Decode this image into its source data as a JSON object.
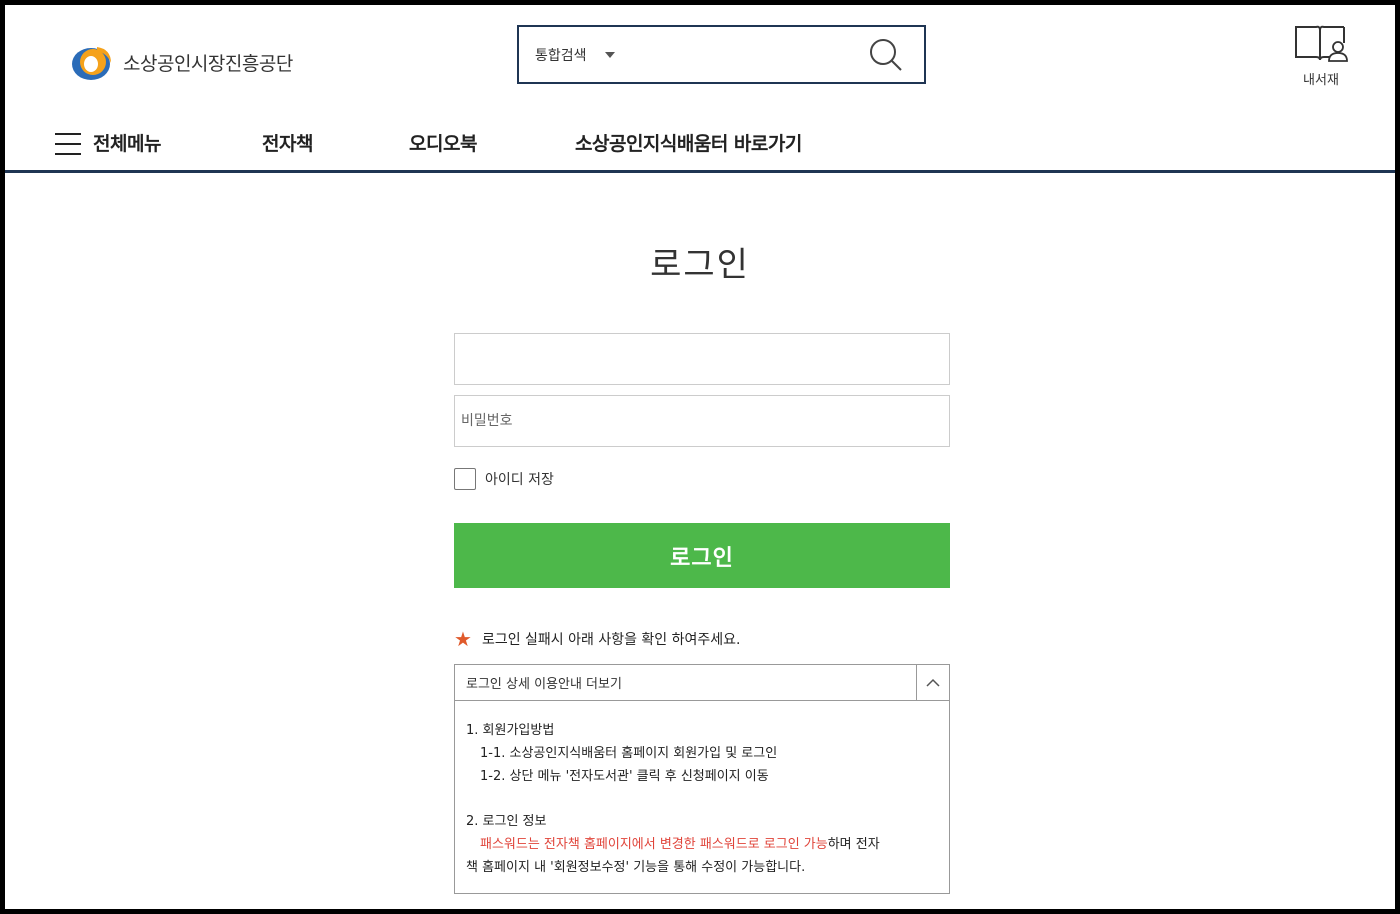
{
  "header": {
    "logo_text": "소상공인시장진흥공단",
    "search": {
      "scope": "통합검색",
      "placeholder": ""
    },
    "mylib_label": "내서재"
  },
  "nav": {
    "all_menu": "전체메뉴",
    "items": [
      "전자책",
      "오디오북",
      "소상공인지식배움터 바로가기"
    ]
  },
  "login": {
    "title": "로그인",
    "id_placeholder": "",
    "password_placeholder": "비밀번호",
    "remember_label": "아이디 저장",
    "submit_label": "로그인"
  },
  "notice": {
    "text": "로그인 실패시 아래 사항을 확인 하여주세요."
  },
  "guide": {
    "title": "로그인 상세 이용안내 더보기",
    "section1_title": "1. 회원가입방법",
    "section1_items": [
      "1-1. 소상공인지식배움터 홈페이지 회원가입 및 로그인",
      "1-2. 상단 메뉴 '전자도서관' 클릭 후 신청페이지 이동"
    ],
    "section2_title": "2. 로그인 정보",
    "section2_highlight": "패스워드는 전자책 홈페이지에서 변경한 패스워드로 로그인 가능",
    "section2_rest_a": "하며 전자",
    "section2_rest_b": "책 홈페이지 내 '회원정보수정' 기능을 통해 수정이 가능합니다."
  },
  "colors": {
    "accent_navy": "#1f3553",
    "login_green": "#4db84a",
    "highlight_red": "#e0443a",
    "star_orange": "#e05a2b"
  }
}
